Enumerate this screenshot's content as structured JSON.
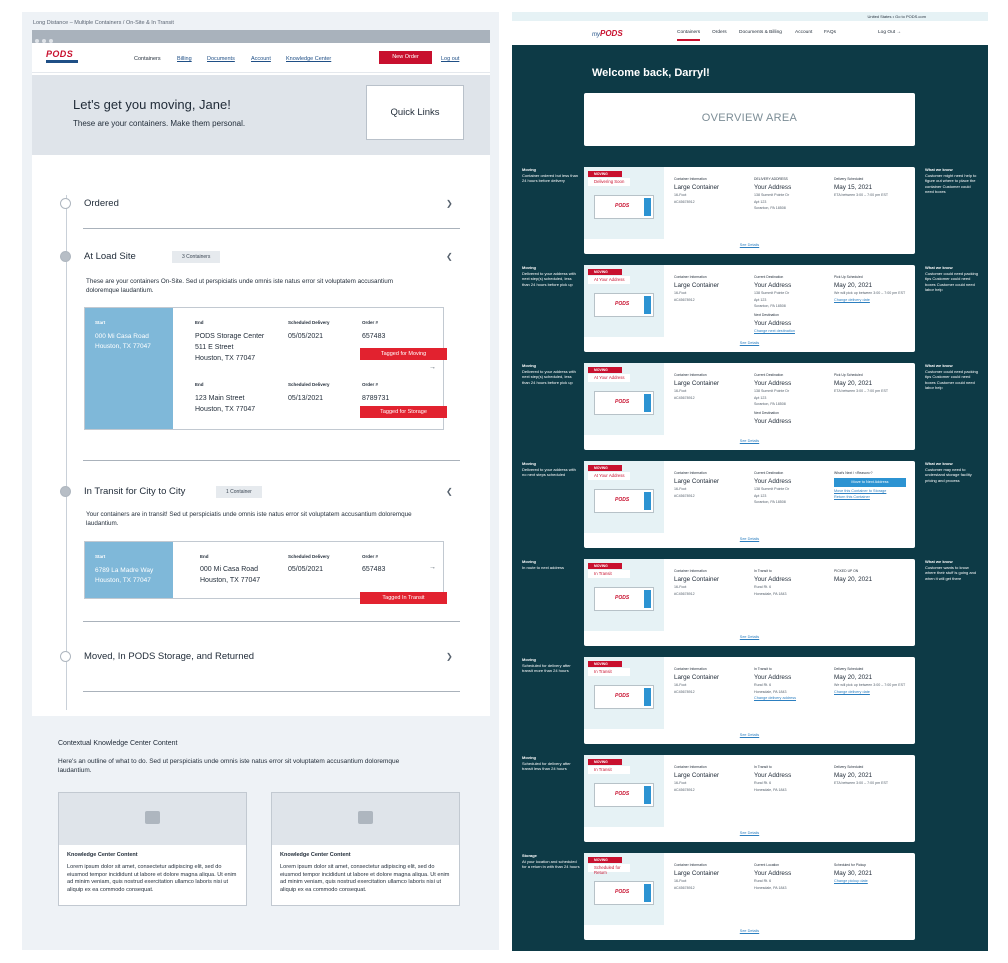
{
  "left": {
    "breadcrumb": "Long Distance – Multiple Containers / On-Site & In Transit",
    "logo": "PODS",
    "nav": [
      {
        "label": "Containers"
      },
      {
        "label": "Billing"
      },
      {
        "label": "Documents"
      },
      {
        "label": "Account"
      },
      {
        "label": "Knowledge Center"
      }
    ],
    "new_order": "New Order",
    "logout": "Log out",
    "hero_title": "Let's get you moving, Jane!",
    "hero_sub": "These are your containers. Make them personal.",
    "quick_links": "Quick Links",
    "stages": {
      "ordered": "Ordered",
      "load": "At Load Site",
      "transit": "In Transit for City to City",
      "moved": "Moved, In PODS Storage, and Returned"
    },
    "load_pill": "3 Containers",
    "transit_pill": "1 Container",
    "load_para": "These are your containers On-Site. Sed ut perspiciatis unde omnis iste natus error sit voluptatem accusantium doloremque laudantium.",
    "transit_para": "Your containers are in transit! Sed ut perspiciatis unde omnis iste natus error sit voluptatem accusantium doloremque laudantium.",
    "labels": {
      "start": "Start",
      "end": "End",
      "sched": "Scheduled Delivery",
      "order": "Order #"
    },
    "card1": {
      "start1": "000 Mi Casa Road",
      "start2": "Houston, TX 77047",
      "r1_end1": "PODS Storage Center",
      "r1_end2": "511 E Street",
      "r1_end3": "Houston, TX 77047",
      "r1_date": "05/05/2021",
      "r1_order": "657483",
      "r1_tag": "Tagged for Moving",
      "r2_end1": "123 Main Street",
      "r2_end2": "Houston, TX 77047",
      "r2_date": "05/13/2021",
      "r2_order": "8789731",
      "r2_tag": "Tagged for Storage"
    },
    "card2": {
      "start1": "6789 La Madre Way",
      "start2": "Houston, TX 77047",
      "end1": "000 Mi Casa Road",
      "end2": "Houston, TX 77047",
      "date": "05/05/2021",
      "order": "657483",
      "tag": "Tagged In Transit"
    },
    "arrow": "→",
    "ctx_title": "Contextual Knowledge Center Content",
    "ctx_intro": "Here's an outline of what to do. Sed ut perspiciatis unde omnis iste natus error sit voluptatem accusantium doloremque laudantium.",
    "kc": [
      {
        "title": "Knowledge Center Content",
        "body": "Lorem ipsum dolor sit amet, consectetur adipiscing elit, sed do eiusmod tempor incididunt ut labore et dolore magna aliqua. Ut enim ad minim veniam, quis nostrud exercitation ullamco laboris nisi ut aliquip ex ea commodo consequat."
      },
      {
        "title": "Knowledge Center Content",
        "body": "Lorem ipsum dolor sit amet, consectetur adipiscing elit, sed do eiusmod tempor incididunt ut labore et dolore magna aliqua. Ut enim ad minim veniam, quis nostrud exercitation ullamco laboris nisi ut aliquip ex ea commodo consequat."
      }
    ]
  },
  "right": {
    "topbar": "United States • Go to PODS.com",
    "logo_my": "my",
    "logo": "PODS",
    "nav": [
      {
        "label": "Containers"
      },
      {
        "label": "Orders"
      },
      {
        "label": "Documents & Billing"
      },
      {
        "label": "Account"
      },
      {
        "label": "FAQs"
      }
    ],
    "logout": "Log Out →",
    "welcome": "Welcome back, Darryl!",
    "overview": "OVERVIEW AREA",
    "mv": "MOVING",
    "see": "See Details",
    "cards": [
      {
        "note_h": "Moving",
        "note": "Container ordered but less than 24 hours before delivery",
        "status": "Delivering Soon",
        "c1h": "Container Information",
        "c1v": "Large Container",
        "c1s": "16-Foot",
        "c1s2": "#C45678912",
        "c2h": "DELIVERY ADDRESS",
        "c2v": "Your Address",
        "c2s": "138 Summit Pointe Dr",
        "c2s2": "Apt 123",
        "c2s3": "Scranton, PA 18508",
        "c3h": "Delivery Scheduled",
        "c3v": "May 15, 2021",
        "c3s": "ETA between 3:00 – 7:00 pm EST",
        "w_h": "What we know",
        "w": "Customer might need help to figure out where to place the container Customer could need boxes"
      },
      {
        "note_h": "Moving",
        "note": "Delivered to your address with next step(s) scheduled, less than 24 hours before pick up",
        "status": "At Your Address",
        "c1h": "Container Information",
        "c1v": "Large Container",
        "c1s": "16-Foot",
        "c1s2": "#C45678912",
        "c2h": "Current Destination",
        "c2v": "Your Address",
        "c2s": "138 Summit Pointe Dr",
        "c2s2": "Apt 123",
        "c2s3": "Scranton, PA 18508",
        "c2nh": "Next Destination",
        "c2nv": "Your Address",
        "c2l": "Change next destination",
        "c3h": "Pick Up Scheduled",
        "c3v": "May 20, 2021",
        "c3s": "We will pick up between 3:00 – 7:00 pm EST",
        "c3l": "Change delivery date",
        "w_h": "What we know",
        "w": "Customer could need packing tips Customer could need boxes Customer could need labor help"
      },
      {
        "note_h": "Moving",
        "note": "Delivered to your address with next step(s) scheduled, less than 24 hours before pick up",
        "status": "At Your Address",
        "c1h": "Container Information",
        "c1v": "Large Container",
        "c1s": "16-Foot",
        "c1s2": "#C45678912",
        "c2h": "Current Destination",
        "c2v": "Your Address",
        "c2s": "138 Summit Pointe Dr",
        "c2s2": "Apt 123",
        "c2s3": "Scranton, PA 18508",
        "c2nh": "Next Destination",
        "c2nv": "Your Address",
        "c3h": "Pick Up Scheduled",
        "c3v": "May 20, 2021",
        "c3s": "ETA between 3:00 – 7:00 pm EST",
        "w_h": "What we know",
        "w": "Customer could need packing tips Customer could need boxes Customer could need labor help"
      },
      {
        "note_h": "Moving",
        "note": "Delivered to your address with no next steps scheduled",
        "status": "At Your Address",
        "c1h": "Container Information",
        "c1v": "Large Container",
        "c1s": "16-Foot",
        "c1s2": "#C45678912",
        "c2h": "Current Destination",
        "c2v": "Your Address",
        "c2s": "138 Summit Pointe Dr",
        "c2s2": "Apt 123",
        "c2s3": "Scranton, PA 18508",
        "c3h": "What's Next / <Reason>?",
        "c3b": "Move to Next Address",
        "c3l": "Move this Container to Storage",
        "c3l2": "Return this Container",
        "w_h": "What we know",
        "w": "Customer may need to understand storage facility pricing and process"
      },
      {
        "note_h": "Moving",
        "note": "In route to next address",
        "status": "In Transit",
        "c1h": "Container Information",
        "c1v": "Large Container",
        "c1s": "16-Foot",
        "c1s2": "#C45678912",
        "c2h": "In Transit to",
        "c2v": "Your Address",
        "c2s": "Rural Rt. 6",
        "c2s2": "Honesdale, PA 1843",
        "c3h": "PICKED UP ON",
        "c3v": "May 20, 2021",
        "w_h": "What we know",
        "w": "Customer wants to know where their stuff is going and when it will get there"
      },
      {
        "note_h": "Moving",
        "note": "Scheduled for delivery after transit more than 24 hours",
        "status": "In Transit",
        "c1h": "Container Information",
        "c1v": "Large Container",
        "c1s": "16-Foot",
        "c1s2": "#C45678912",
        "c2h": "In Transit to",
        "c2v": "Your Address",
        "c2s": "Rural Rt. 6",
        "c2s2": "Honesdale, PA 1843",
        "c2l": "Change delivery address",
        "c3h": "Delivery Scheduled",
        "c3v": "May 20, 2021",
        "c3s": "We will pick up between 3:00 – 7:00 pm EST",
        "c3l": "Change delivery date"
      },
      {
        "note_h": "Moving",
        "note": "Scheduled for delivery after transit less than 24 hours",
        "status": "In Transit",
        "c1h": "Container Information",
        "c1v": "Large Container",
        "c1s": "16-Foot",
        "c1s2": "#C45678912",
        "c2h": "In Transit to",
        "c2v": "Your Address",
        "c2s": "Rural Rt. 6",
        "c2s2": "Honesdale, PA 1843",
        "c3h": "Delivery Scheduled",
        "c3v": "May 20, 2021",
        "c3s": "ETA between 3:00 – 7:00 pm EST"
      },
      {
        "note_h": "Storage",
        "note": "At your location and scheduled for a return in with than 24 hours",
        "status": "Scheduled for Return",
        "c1h": "Container Information",
        "c1v": "Large Container",
        "c1s": "16-Foot",
        "c1s2": "#C45678912",
        "c2h": "Current Location",
        "c2v": "Your Address",
        "c2s": "Rural Rt. 6",
        "c2s2": "Honesdale, PA 1843",
        "c3h": "Scheduled for Pickup",
        "c3v": "May 30, 2021",
        "c3l": "Change pickup date"
      }
    ]
  }
}
